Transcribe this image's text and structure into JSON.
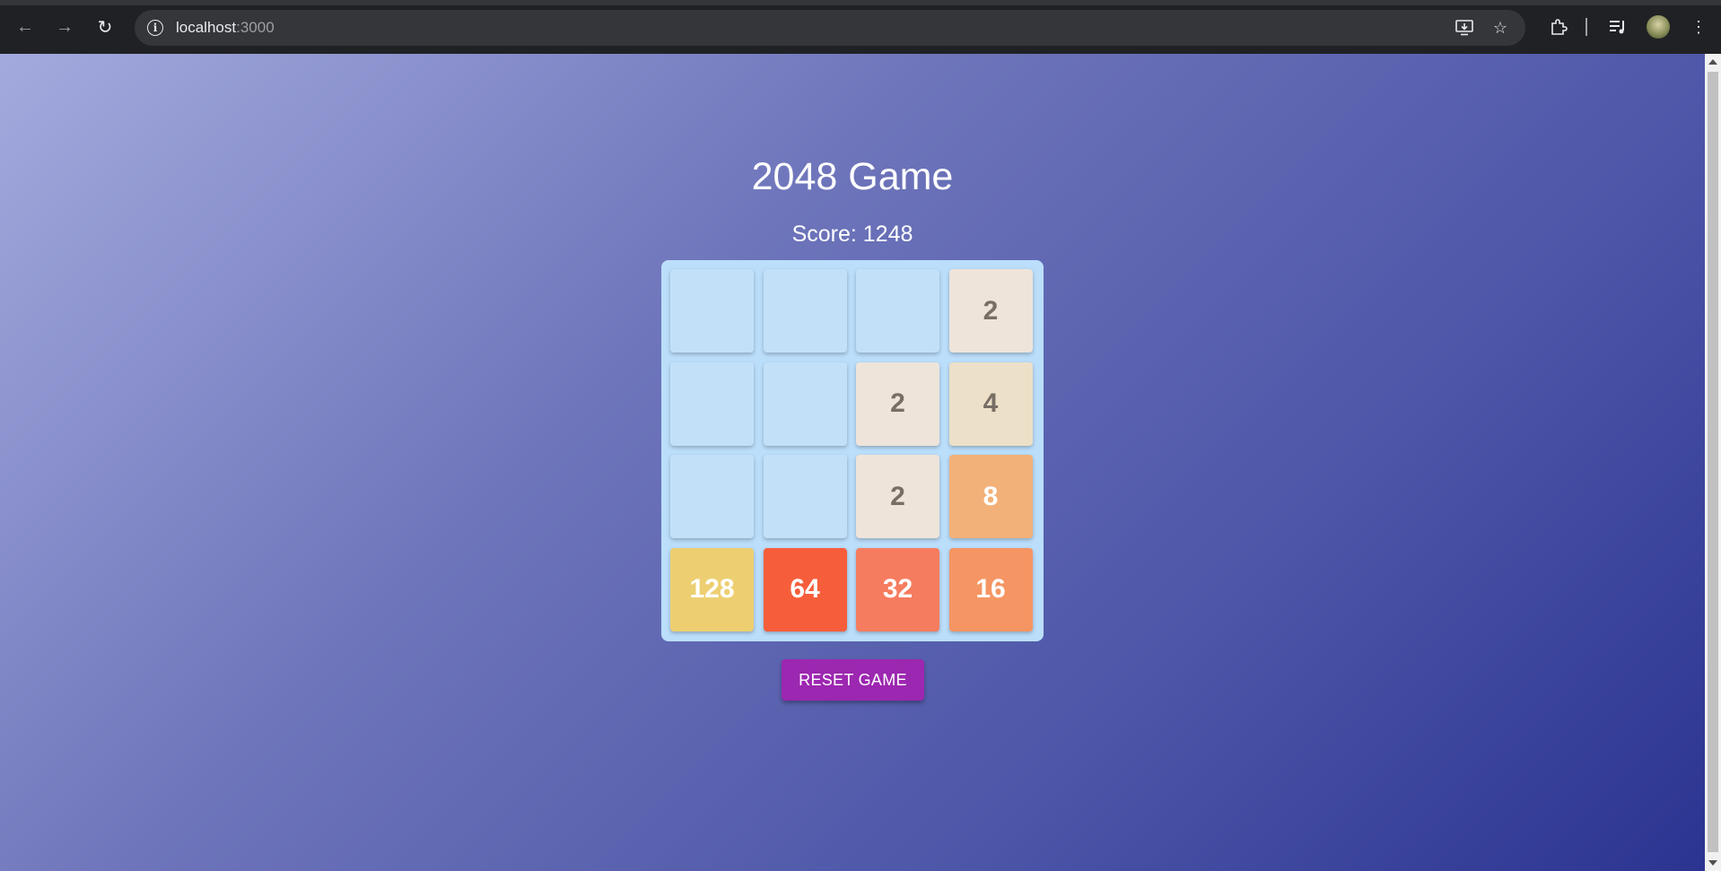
{
  "browser": {
    "url_host": "localhost",
    "url_port": ":3000"
  },
  "game": {
    "title": "2048 Game",
    "score_label": "Score: 1248",
    "reset_label": "RESET GAME",
    "board": [
      [
        null,
        null,
        null,
        2
      ],
      [
        null,
        null,
        2,
        4
      ],
      [
        null,
        null,
        2,
        8
      ],
      [
        128,
        64,
        32,
        16
      ]
    ]
  },
  "colors": {
    "empty": "#c2e1f9",
    "board_bg": "#bbdefb",
    "dark_text": "#776e65",
    "light_text": "#ffffff",
    "tiles": {
      "2": "#eee4da",
      "4": "#ede0c8",
      "8": "#f2b179",
      "16": "#f59563",
      "32": "#f67c5f",
      "64": "#f65e3b",
      "128": "#edcf72"
    },
    "reset_button": "#9c27b0"
  },
  "icons": {
    "back": "arrow-left-icon",
    "forward": "arrow-right-icon",
    "reload": "reload-icon",
    "site_info": "info-icon",
    "install": "install-app-icon",
    "bookmark": "star-icon",
    "extensions": "puzzle-icon",
    "media": "media-control-icon",
    "menu": "kebab-menu-icon"
  }
}
